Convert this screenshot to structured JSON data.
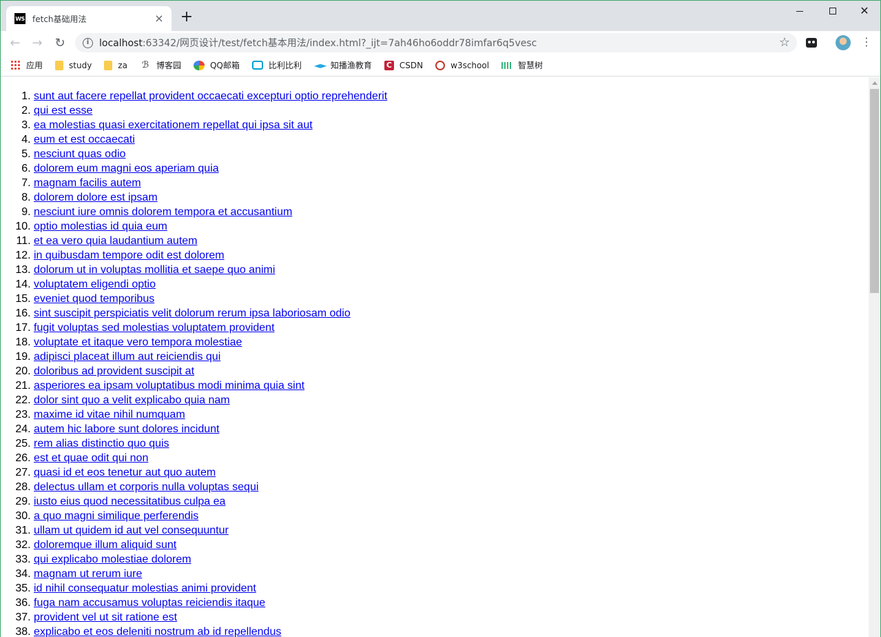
{
  "browser": {
    "tab": {
      "favicon_text": "WS",
      "title": "fetch基础用法",
      "close_glyph": "×"
    },
    "new_tab_glyph": "+",
    "window_controls": {
      "close_glyph": "✕"
    },
    "nav": {
      "back_glyph": "←",
      "forward_glyph": "→",
      "reload_glyph": "↻"
    },
    "address": {
      "host": "localhost",
      "rest": ":63342/网页设计/test/fetch基本用法/index.html?_ijt=7ah46ho6oddr78imfar6q5vesc"
    },
    "star_glyph": "☆",
    "menu_glyph": "⋮",
    "bookmarks": [
      {
        "label": "应用",
        "icon": "apps-icon"
      },
      {
        "label": "study",
        "icon": "folder-icon"
      },
      {
        "label": "za",
        "icon": "folder-icon"
      },
      {
        "label": "博客园",
        "icon": "cnblogs-icon"
      },
      {
        "label": "QQ邮箱",
        "icon": "qq-mail-icon"
      },
      {
        "label": "比利比利",
        "icon": "bilibili-icon"
      },
      {
        "label": "知播渔教育",
        "icon": "zhiboyu-icon"
      },
      {
        "label": "CSDN",
        "icon": "csdn-icon"
      },
      {
        "label": "w3school",
        "icon": "w3school-icon"
      },
      {
        "label": "智慧树",
        "icon": "zhihuishu-icon"
      }
    ]
  },
  "posts": [
    "sunt aut facere repellat provident occaecati excepturi optio reprehenderit",
    "qui est esse",
    "ea molestias quasi exercitationem repellat qui ipsa sit aut",
    "eum et est occaecati",
    "nesciunt quas odio",
    "dolorem eum magni eos aperiam quia",
    "magnam facilis autem",
    "dolorem dolore est ipsam",
    "nesciunt iure omnis dolorem tempora et accusantium",
    "optio molestias id quia eum",
    "et ea vero quia laudantium autem",
    "in quibusdam tempore odit est dolorem",
    "dolorum ut in voluptas mollitia et saepe quo animi",
    "voluptatem eligendi optio",
    "eveniet quod temporibus",
    "sint suscipit perspiciatis velit dolorum rerum ipsa laboriosam odio",
    "fugit voluptas sed molestias voluptatem provident",
    "voluptate et itaque vero tempora molestiae",
    "adipisci placeat illum aut reiciendis qui",
    "doloribus ad provident suscipit at",
    "asperiores ea ipsam voluptatibus modi minima quia sint",
    "dolor sint quo a velit explicabo quia nam",
    "maxime id vitae nihil numquam",
    "autem hic labore sunt dolores incidunt",
    "rem alias distinctio quo quis",
    "est et quae odit qui non",
    "quasi id et eos tenetur aut quo autem",
    "delectus ullam et corporis nulla voluptas sequi",
    "iusto eius quod necessitatibus culpa ea",
    "a quo magni similique perferendis",
    "ullam ut quidem id aut vel consequuntur",
    "doloremque illum aliquid sunt",
    "qui explicabo molestiae dolorem",
    "magnam ut rerum iure",
    "id nihil consequatur molestias animi provident",
    "fuga nam accusamus voluptas reiciendis itaque",
    "provident vel ut sit ratione est",
    "explicabo et eos deleniti nostrum ab id repellendus"
  ]
}
